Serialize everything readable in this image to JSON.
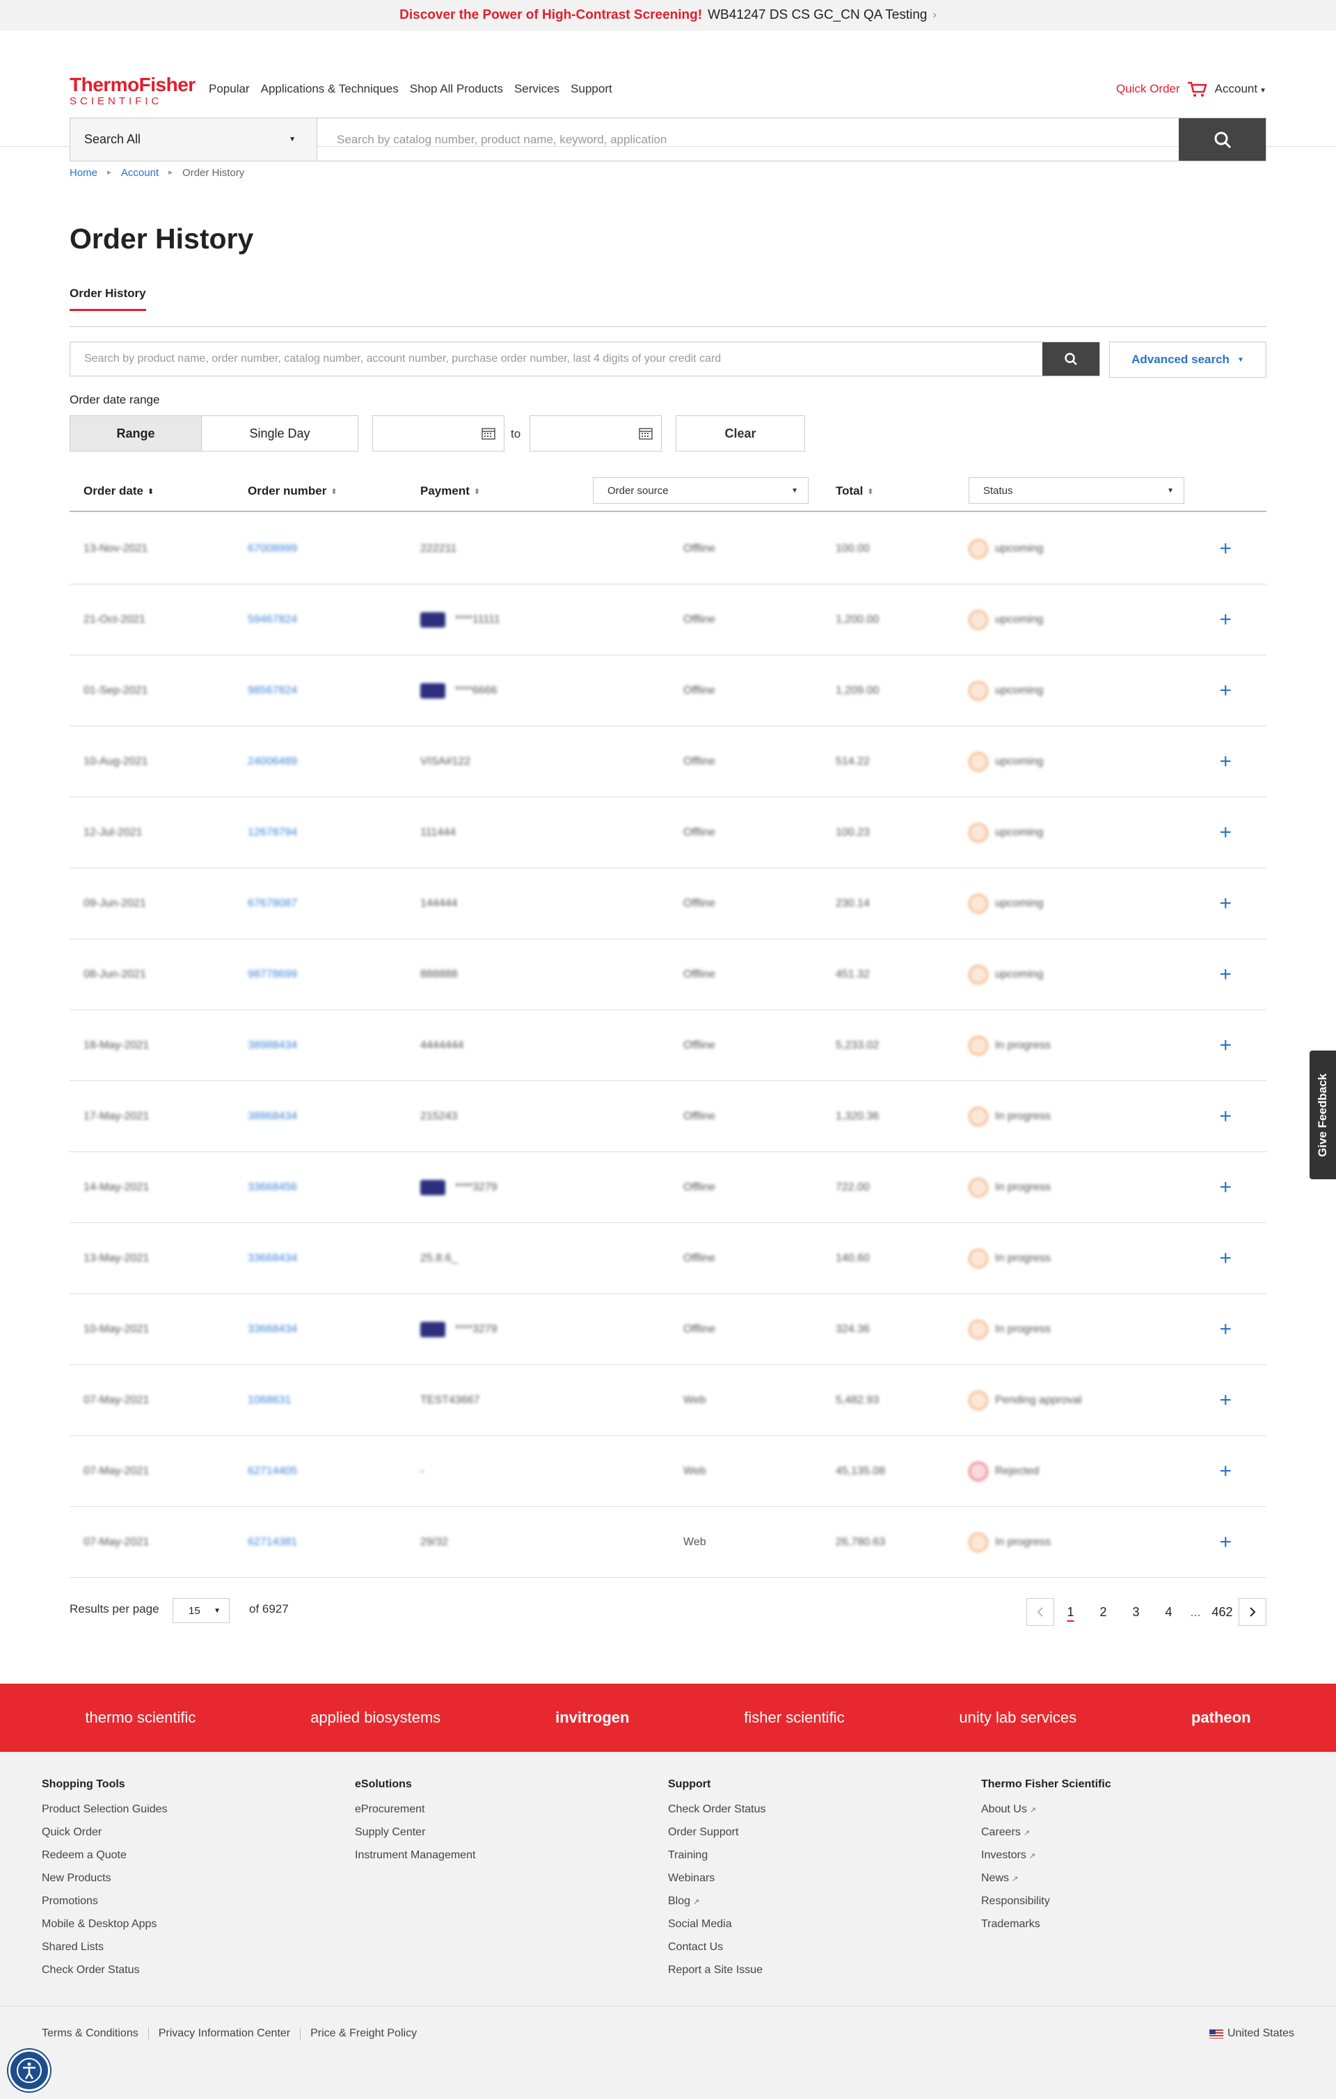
{
  "promo": {
    "highlight": "Discover the Power of High-Contrast Screening!",
    "text": "WB41247 DS CS GC_CN QA Testing",
    "chevron": "›"
  },
  "header": {
    "logo_line1": "ThermoFisher",
    "logo_line2": "SCIENTIFIC",
    "nav": [
      "Popular",
      "Applications & Techniques",
      "Shop All Products",
      "Services",
      "Support"
    ],
    "quick_order": "Quick Order",
    "account": "Account",
    "search_category": "Search All",
    "search_placeholder": "Search by catalog number, product name, keyword, application"
  },
  "breadcrumb": {
    "home": "Home",
    "account": "Account",
    "current": "Order History",
    "separator": "►"
  },
  "page_title": "Order History",
  "tab_active": "Order History",
  "order_search": {
    "placeholder": "Search by product name, order number, catalog number, account number, purchase order number, last 4 digits of your credit card",
    "advanced": "Advanced search"
  },
  "date_range": {
    "label": "Order date range",
    "range": "Range",
    "single_day": "Single Day",
    "to": "to",
    "clear": "Clear"
  },
  "table": {
    "headers": {
      "order_date": "Order date",
      "order_number": "Order number",
      "payment": "Payment",
      "order_source": "Order source",
      "total": "Total",
      "status": "Status"
    },
    "rows": [
      {
        "date": "13-Nov-2021",
        "number": "67008999",
        "payment": "222211",
        "visa": false,
        "source": "Offline",
        "total": "100.00",
        "status": "upcoming",
        "status_type": "pending"
      },
      {
        "date": "21-Oct-2021",
        "number": "59467824",
        "payment": "****11111",
        "visa": true,
        "source": "Offline",
        "total": "1,200.00",
        "status": "upcoming",
        "status_type": "pending"
      },
      {
        "date": "01-Sep-2021",
        "number": "98567824",
        "payment": "****6666",
        "visa": true,
        "source": "Offline",
        "total": "1,209.00",
        "status": "upcoming",
        "status_type": "pending"
      },
      {
        "date": "10-Aug-2021",
        "number": "24006489",
        "payment": "VISA#122",
        "visa": false,
        "source": "Offline",
        "total": "514.22",
        "status": "upcoming",
        "status_type": "pending"
      },
      {
        "date": "12-Jul-2021",
        "number": "12678794",
        "payment": "111444",
        "visa": false,
        "source": "Offline",
        "total": "100.23",
        "status": "upcoming",
        "status_type": "pending"
      },
      {
        "date": "09-Jun-2021",
        "number": "67678087",
        "payment": "144444",
        "visa": false,
        "source": "Offline",
        "total": "230.14",
        "status": "upcoming",
        "status_type": "pending"
      },
      {
        "date": "08-Jun-2021",
        "number": "98778699",
        "payment": "888888",
        "visa": false,
        "source": "Offline",
        "total": "451.32",
        "status": "upcoming",
        "status_type": "pending"
      },
      {
        "date": "18-May-2021",
        "number": "38988434",
        "payment": "4444444",
        "visa": false,
        "source": "Offline",
        "total": "5,233.02",
        "status": "In progress",
        "status_type": "pending"
      },
      {
        "date": "17-May-2021",
        "number": "38868434",
        "payment": "215243",
        "visa": false,
        "source": "Offline",
        "total": "1,320.36",
        "status": "In progress",
        "status_type": "pending"
      },
      {
        "date": "14-May-2021",
        "number": "33668456",
        "payment": "****3279",
        "visa": true,
        "source": "Offline",
        "total": "722.00",
        "status": "In progress",
        "status_type": "pending"
      },
      {
        "date": "13-May-2021",
        "number": "33668434",
        "payment": "25.8.6_",
        "visa": false,
        "source": "Offline",
        "total": "140.60",
        "status": "In progress",
        "status_type": "pending"
      },
      {
        "date": "10-May-2021",
        "number": "33668434",
        "payment": "****3279",
        "visa": true,
        "source": "Offline",
        "total": "324.36",
        "status": "In progress",
        "status_type": "pending"
      },
      {
        "date": "07-May-2021",
        "number": "1068631",
        "payment": "TEST43667",
        "visa": false,
        "source": "Web",
        "total": "5,482.93",
        "status": "Pending approval",
        "status_type": "pending"
      },
      {
        "date": "07-May-2021",
        "number": "62714405",
        "payment": "-",
        "visa": false,
        "source": "Web",
        "total": "45,135.08",
        "status": "Rejected",
        "status_type": "rejected"
      },
      {
        "date": "07-May-2021",
        "number": "62714381",
        "payment": "29/32",
        "visa": false,
        "source": "Web",
        "total": "26,780.63",
        "status": "In progress",
        "status_type": "pending"
      }
    ]
  },
  "pagination": {
    "rpp_label": "Results per page",
    "rpp_value": "15",
    "of_total": "of 6927",
    "pages": [
      "1",
      "2",
      "3",
      "4"
    ],
    "ellipsis": "...",
    "last": "462"
  },
  "brands": [
    "thermo scientific",
    "applied biosystems",
    "invitrogen",
    "fisher scientific",
    "unity lab services",
    "patheon"
  ],
  "footer": {
    "columns": [
      {
        "title": "Shopping Tools",
        "items": [
          "Product Selection Guides",
          "Quick Order",
          "Redeem a Quote",
          "New Products",
          "Promotions",
          "Mobile & Desktop Apps",
          "Shared Lists",
          "Check Order Status"
        ]
      },
      {
        "title": "eSolutions",
        "items": [
          "eProcurement",
          "Supply Center",
          "Instrument Management"
        ]
      },
      {
        "title": "Support",
        "items": [
          "Check Order Status",
          "Order Support",
          "Training",
          "Webinars",
          "Blog",
          "Social Media",
          "Contact Us",
          "Report a Site Issue"
        ]
      },
      {
        "title": "Thermo Fisher Scientific",
        "items": [
          "About Us",
          "Careers",
          "Investors",
          "News",
          "Responsibility",
          "Trademarks"
        ]
      }
    ],
    "legal": [
      "Terms & Conditions",
      "Privacy Information Center",
      "Price & Freight Policy"
    ],
    "country": "United States"
  },
  "feedback": "Give Feedback",
  "colors": {
    "brand_red": "#e31d2b",
    "link_blue": "#2a73cc",
    "dark_button": "#444444"
  }
}
